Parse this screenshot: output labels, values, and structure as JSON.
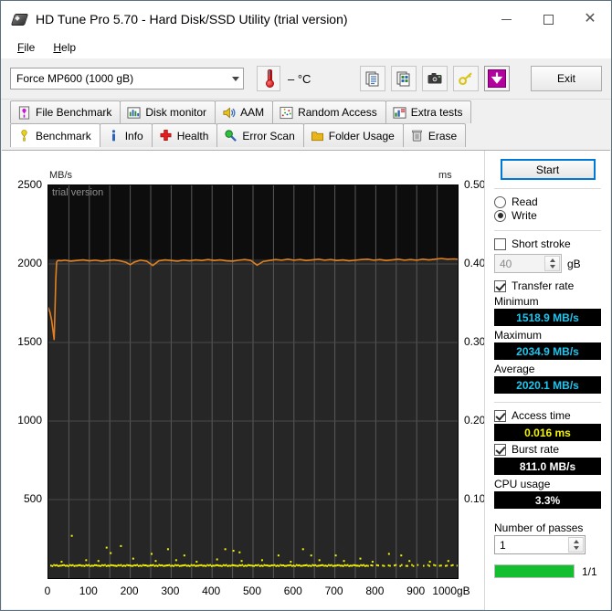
{
  "window": {
    "title": "HD Tune Pro 5.70 - Hard Disk/SSD Utility (trial version)",
    "minimize": "–",
    "maximize": "□",
    "close": "✕"
  },
  "menu": {
    "items": [
      "File",
      "Help"
    ]
  },
  "toolbar": {
    "drive": "Force MP600 (1000 gB)",
    "temperature": "– °C",
    "exit_label": "Exit",
    "icons": [
      "thermometer-icon",
      "copy-text-icon",
      "copy-image-icon",
      "screenshot-icon",
      "key-icon",
      "download-icon"
    ]
  },
  "tabs": {
    "top_row": [
      {
        "label": "File Benchmark",
        "icon": "file-benchmark-icon",
        "active": false
      },
      {
        "label": "Disk monitor",
        "icon": "disk-monitor-icon",
        "active": false
      },
      {
        "label": "AAM",
        "icon": "speaker-icon",
        "active": false
      },
      {
        "label": "Random Access",
        "icon": "random-access-icon",
        "active": false
      },
      {
        "label": "Extra tests",
        "icon": "extra-tests-icon",
        "active": false
      }
    ],
    "bottom_row": [
      {
        "label": "Benchmark",
        "icon": "benchmark-icon",
        "active": true
      },
      {
        "label": "Info",
        "icon": "info-icon",
        "active": false
      },
      {
        "label": "Health",
        "icon": "health-icon",
        "active": false
      },
      {
        "label": "Error Scan",
        "icon": "error-scan-icon",
        "active": false
      },
      {
        "label": "Folder Usage",
        "icon": "folder-usage-icon",
        "active": false
      },
      {
        "label": "Erase",
        "icon": "erase-icon",
        "active": false
      }
    ]
  },
  "panel": {
    "start_label": "Start",
    "mode": {
      "read_label": "Read",
      "write_label": "Write",
      "selected": "Write"
    },
    "short_stroke": {
      "label": "Short stroke",
      "checked": false,
      "value": "40",
      "unit": "gB"
    },
    "transfer_rate": {
      "label": "Transfer rate",
      "checked": true,
      "minimum_label": "Minimum",
      "minimum_value": "1518.9 MB/s",
      "maximum_label": "Maximum",
      "maximum_value": "2034.9 MB/s",
      "average_label": "Average",
      "average_value": "2020.1 MB/s"
    },
    "access_time": {
      "label": "Access time",
      "checked": true,
      "value": "0.016 ms"
    },
    "burst_rate": {
      "label": "Burst rate",
      "checked": true,
      "value": "811.0 MB/s"
    },
    "cpu_usage": {
      "label": "CPU usage",
      "value": "3.3%"
    },
    "passes": {
      "label": "Number of passes",
      "value": "1",
      "progress_label": "1/1",
      "progress_percent": 100
    },
    "colors": {
      "value_cyan": "#1ec6ef",
      "value_yellow": "#f2f20a",
      "value_white": "#ffffff",
      "progress_green": "#13bf2e",
      "focus_blue": "#0078d7"
    }
  },
  "chart_data": {
    "type": "line",
    "title": "",
    "watermark": "trial version",
    "ylabel": "MB/s",
    "ylabel_right": "ms",
    "xlabel": "gB",
    "ylim": [
      0,
      2500
    ],
    "ylim_right": [
      0,
      0.5
    ],
    "xlim": [
      0,
      1000
    ],
    "grid": true,
    "y_ticks": [
      500,
      1000,
      1500,
      2000,
      2500
    ],
    "y_ticks_right": [
      "0.10",
      "0.20",
      "0.30",
      "0.40",
      "0.50"
    ],
    "x_ticks": [
      0,
      100,
      200,
      300,
      400,
      500,
      600,
      700,
      800,
      900,
      1000
    ],
    "x_tick_labels": [
      "0",
      "100",
      "200",
      "300",
      "400",
      "500",
      "600",
      "700",
      "800",
      "900",
      "1000"
    ],
    "x_unit_suffix": "gB",
    "series": [
      {
        "name": "Transfer rate",
        "color": "#e08020",
        "axis": "left",
        "units": "MB/s",
        "x": [
          0,
          4,
          8,
          10,
          12,
          14,
          16,
          18,
          20,
          22,
          26,
          30,
          40,
          55,
          70,
          85,
          100,
          115,
          130,
          145,
          160,
          175,
          190,
          200,
          210,
          225,
          240,
          255,
          270,
          285,
          300,
          315,
          330,
          345,
          360,
          375,
          390,
          405,
          420,
          435,
          450,
          465,
          480,
          495,
          510,
          525,
          540,
          555,
          570,
          585,
          600,
          615,
          630,
          645,
          660,
          675,
          690,
          705,
          720,
          735,
          750,
          765,
          780,
          795,
          810,
          825,
          840,
          855,
          870,
          885,
          900,
          915,
          930,
          945,
          960,
          975,
          990,
          1000
        ],
        "y": [
          1720,
          1690,
          1640,
          1600,
          1560,
          1518.9,
          1700,
          1900,
          2010,
          2020,
          2022,
          2020,
          2024,
          2018,
          2022,
          2026,
          2020,
          2024,
          2018,
          2022,
          2026,
          2020,
          2010,
          1995,
          2012,
          2024,
          2018,
          1990,
          2020,
          2026,
          2022,
          2018,
          2024,
          2020,
          2026,
          2022,
          2028,
          2022,
          2026,
          2020,
          2018,
          2024,
          2028,
          2022,
          1992,
          2016,
          2022,
          2028,
          2024,
          2030,
          2024,
          2028,
          2022,
          2026,
          2030,
          2024,
          2028,
          2022,
          2026,
          2020,
          2024,
          2028,
          2030,
          2024,
          2028,
          2022,
          2026,
          2030,
          2024,
          2028,
          2024,
          2030,
          2026,
          2030,
          2034.9,
          2030,
          2032,
          2030
        ]
      },
      {
        "name": "Access time",
        "color": "#f2f20a",
        "axis": "right",
        "units": "ms",
        "style": "scatter",
        "baseline": 0.016,
        "spike_x": [
          55,
          140,
          150,
          175,
          250,
          290,
          330,
          430,
          450,
          465,
          560,
          620,
          640,
          700,
          830,
          860
        ],
        "spike_y": [
          0.055,
          0.04,
          0.033,
          0.042,
          0.032,
          0.038,
          0.03,
          0.038,
          0.036,
          0.034,
          0.03,
          0.038,
          0.03,
          0.03,
          0.032,
          0.03
        ]
      }
    ]
  }
}
